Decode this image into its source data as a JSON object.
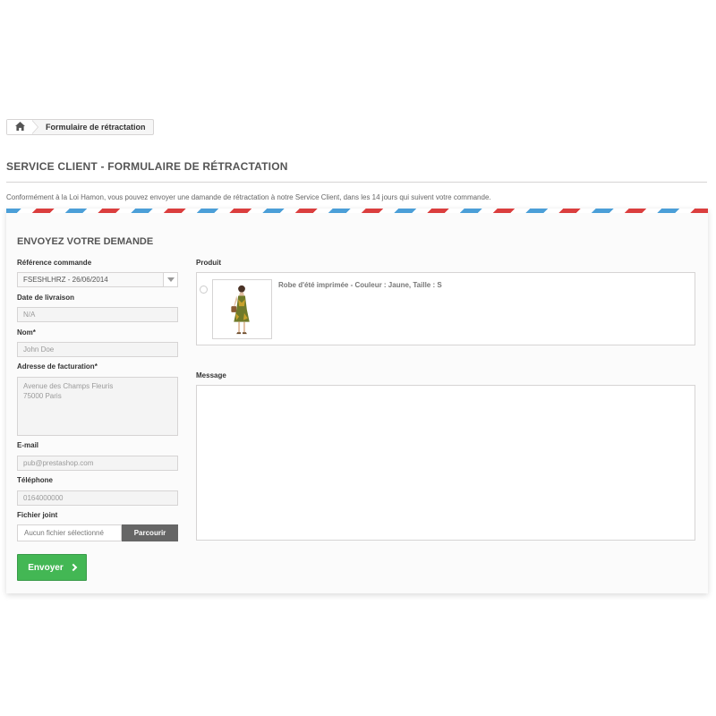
{
  "breadcrumb": {
    "home_icon": "home-icon",
    "current": "Formulaire de rétractation"
  },
  "page": {
    "heading": "SERVICE CLIENT - FORMULAIRE DE RÉTRACTATION",
    "intro": "Conformément à la Loi Hamon, vous pouvez envoyer une damande de rétractation à notre Service Client, dans les 14 jours qui suivent votre commande."
  },
  "form": {
    "title": "ENVOYEZ VOTRE DEMANDE",
    "order_ref_label": "Référence commande",
    "order_ref_value": "FSESHLHRZ - 26/06/2014",
    "delivery_date_label": "Date de livraison",
    "delivery_date_value": "N/A",
    "name_label": "Nom*",
    "name_value": "John Doe",
    "billing_label": "Adresse de facturation*",
    "billing_line1": "Avenue des Champs Fleuris",
    "billing_line2": "75000 Paris",
    "email_label": "E-mail",
    "email_value": "pub@prestashop.com",
    "phone_label": "Téléphone",
    "phone_value": "0164000000",
    "file_label": "Fichier joint",
    "file_placeholder": "Aucun fichier sélectionné",
    "file_button": "Parcourir",
    "submit_label": "Envoyer",
    "product_label": "Produit",
    "product_name": "Robe d'été imprimée - Couleur : Jaune, Taille : S",
    "message_label": "Message"
  },
  "colors": {
    "accent_green": "#43b754",
    "airmail_red": "#db3e3e",
    "airmail_blue": "#4b9fd8"
  }
}
